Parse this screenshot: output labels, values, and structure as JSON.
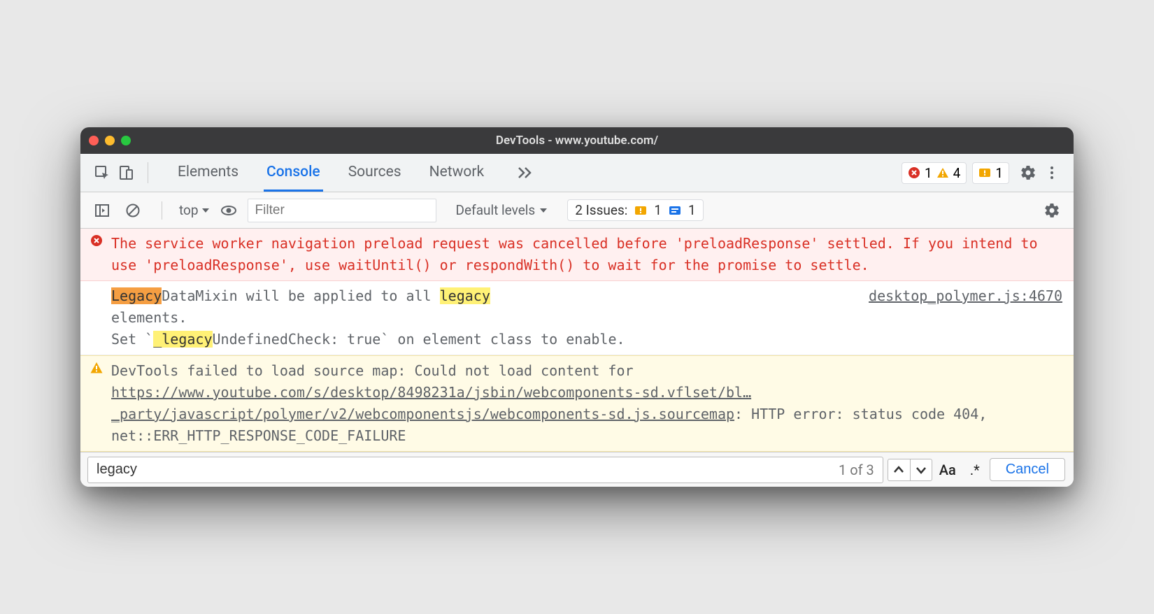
{
  "window": {
    "title": "DevTools - www.youtube.com/"
  },
  "toolbar1": {
    "tabs": [
      "Elements",
      "Console",
      "Sources",
      "Network"
    ],
    "active_tab": 1,
    "error_count": "1",
    "warning_count": "4",
    "issue_breaking_count": "1"
  },
  "toolbar2": {
    "context": "top",
    "filter_placeholder": "Filter",
    "levels_label": "Default levels",
    "issues_label": "2 Issues:",
    "issues_breaking": "1",
    "issues_info": "1"
  },
  "messages": {
    "error_text": "The service worker navigation preload request was cancelled before 'preloadResponse' settled. If you intend to use 'preloadResponse', use waitUntil() or respondWith() to wait for the promise to settle.",
    "log": {
      "pre1": "",
      "hl_cur": "Legacy",
      "mid1": "DataMixin will be applied to all ",
      "hl2": "legacy",
      "mid2": " elements.",
      "line2_pre": "Set `",
      "line2_hl": "_legacy",
      "line2_post": "UndefinedCheck: true` on element class to enable.",
      "source": "desktop_polymer.js:4670"
    },
    "warning": {
      "prefix": "DevTools failed to load source map: Could not load content for ",
      "link": "https://www.youtube.com/s/desktop/8498231a/jsbin/webcomponents-sd.vflset/bl…_party/javascript/polymer/v2/webcomponentsjs/webcomponents-sd.js.sourcemap",
      "suffix": ": HTTP error: status code 404, net::ERR_HTTP_RESPONSE_CODE_FAILURE"
    }
  },
  "findbar": {
    "value": "legacy",
    "count": "1 of 3",
    "match_case": "Aa",
    "regex": ".*",
    "cancel": "Cancel"
  }
}
